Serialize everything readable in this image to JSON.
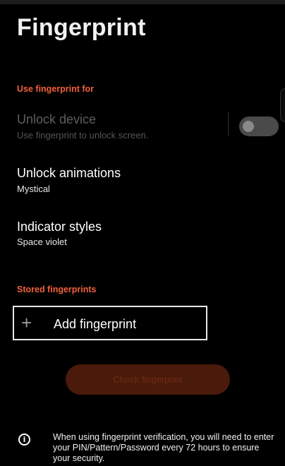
{
  "header": {
    "title": "Fingerprint"
  },
  "sections": {
    "use_for": "Use fingerprint for",
    "stored": "Stored fingerprints"
  },
  "unlock_device": {
    "title": "Unlock device",
    "subtitle": "Use fingerprint to unlock screen.",
    "toggle_on": false
  },
  "unlock_animations": {
    "title": "Unlock animations",
    "value": "Mystical"
  },
  "indicator_styles": {
    "title": "Indicator styles",
    "value": "Space violet"
  },
  "add_fingerprint": {
    "icon": "plus-icon",
    "label": "Add fingerprint"
  },
  "check_button": {
    "label": "Check fingerprint"
  },
  "info": {
    "icon": "info-icon",
    "text": "When using fingerprint verification, you will need to enter your PIN/Pattern/Password every 72 hours to ensure your security."
  },
  "colors": {
    "accent": "#f0603c",
    "background": "#000000",
    "button_disabled": "#4a1a0a"
  }
}
